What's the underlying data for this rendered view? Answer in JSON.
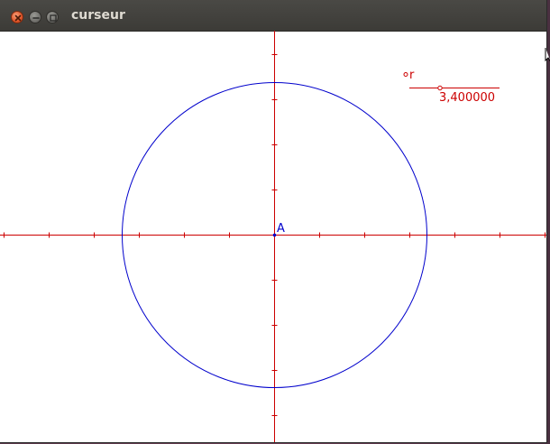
{
  "window": {
    "title": "curseur"
  },
  "figure": {
    "point_label": "A",
    "slider": {
      "name": "r",
      "value": "3,400000"
    },
    "colors": {
      "axis": "#cc0000",
      "circle": "#0000cc",
      "point": "#0000cc",
      "slider": "#cc0000"
    }
  }
}
